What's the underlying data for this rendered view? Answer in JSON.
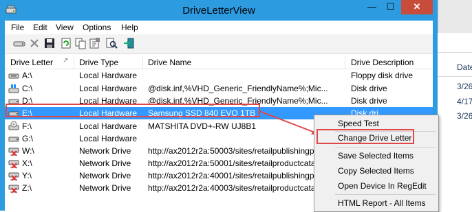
{
  "window": {
    "title": "DriveLetterView"
  },
  "caption_buttons": {
    "minimize": "—",
    "maximize": "☐",
    "close": "✕"
  },
  "menu": [
    "File",
    "Edit",
    "View",
    "Options",
    "Help"
  ],
  "toolbar": {
    "icons": [
      "drive-icon",
      "delete-icon",
      "save-icon",
      "refresh-icon",
      "copy-icon",
      "properties-icon",
      "find-icon",
      "exit-icon"
    ]
  },
  "columns": [
    "Drive Letter",
    "Drive Type",
    "Drive Name",
    "Drive Description"
  ],
  "rows": [
    {
      "letter": "A:\\",
      "type": "Local Hardware",
      "name": "",
      "desc": "Floppy disk drive",
      "icon": "floppy-drive-icon"
    },
    {
      "letter": "C:\\",
      "type": "Local Hardware",
      "name": "@disk.inf,%VHD_Generic_FriendlyName%;Mic...",
      "desc": "Disk drive",
      "icon": "windows-drive-icon"
    },
    {
      "letter": "D:\\",
      "type": "Local Hardware",
      "name": "@disk.inf,%VHD_Generic_FriendlyName%;Mic...",
      "desc": "Disk drive",
      "icon": "hard-drive-icon"
    },
    {
      "letter": "E:\\",
      "type": "Local Hardware",
      "name": "Samsung SSD 840 EVO 1TB",
      "desc": "Disk dri",
      "icon": "hard-drive-icon"
    },
    {
      "letter": "F:\\",
      "type": "Local Hardware",
      "name": "MATSHITA DVD+-RW UJ8B1",
      "desc": "",
      "icon": "dvd-drive-icon"
    },
    {
      "letter": "G:\\",
      "type": "Local Hardware",
      "name": "",
      "desc": "",
      "icon": "hard-drive-icon"
    },
    {
      "letter": "W:\\",
      "type": "Network Drive",
      "name": "http://ax2012r2a:50003/sites/retailpublishingp",
      "desc": "",
      "icon": "network-drive-icon"
    },
    {
      "letter": "X:\\",
      "type": "Network Drive",
      "name": "http://ax2012r2a:50001/sites/retailproductcata",
      "desc": "",
      "icon": "network-drive-icon"
    },
    {
      "letter": "Y:\\",
      "type": "Network Drive",
      "name": "http://ax2012r2a:40001/sites/retailpublishingp",
      "desc": "",
      "icon": "network-drive-icon"
    },
    {
      "letter": "Z:\\",
      "type": "Network Drive",
      "name": "http://ax2012r2a:40003/sites/retailproductcata",
      "desc": "",
      "icon": "network-drive-icon"
    }
  ],
  "context_menu": {
    "items": [
      "Speed Test",
      "Change Drive Letter",
      "Save Selected Items",
      "Copy Selected Items",
      "Open Device In RegEdit",
      "HTML Report - All Items"
    ],
    "highlighted": "Change Drive Letter"
  },
  "background_window": {
    "header": "Date",
    "dates": [
      "3/26",
      "4/17",
      "3/26"
    ]
  },
  "colors": {
    "accent": "#2c9be0",
    "selection": "#3399ff",
    "annotation": "#e04848",
    "close": "#c74d3a"
  }
}
